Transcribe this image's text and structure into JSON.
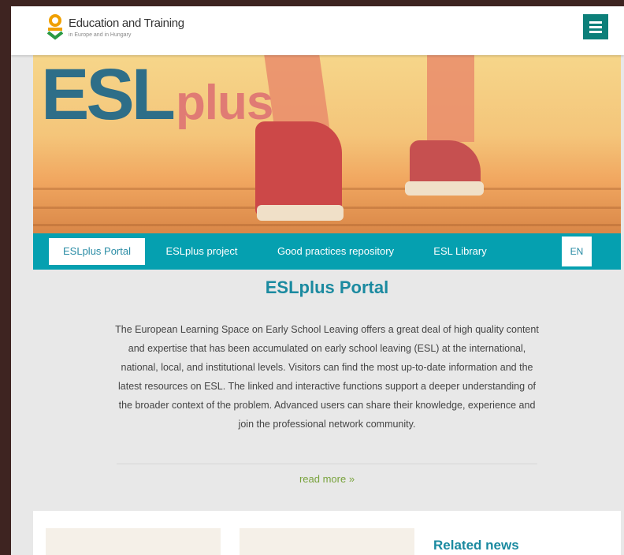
{
  "header": {
    "logo_title": "Education and Training",
    "logo_subtitle": "in Europe and in Hungary",
    "menu_icon": "hamburger-menu-icon"
  },
  "hero": {
    "brand_esl": "ESL",
    "brand_plus": "plus"
  },
  "nav": {
    "items": [
      "ESLplus Portal",
      "ESLplus project",
      "Good practices repository",
      "ESL Library"
    ],
    "active_index": 0,
    "lang": "EN"
  },
  "main": {
    "title": "ESLplus Portal",
    "intro": "The European Learning Space on Early School Leaving offers a great deal of high quality content and expertise that has been accumulated on early school leaving (ESL) at the international, national, local, and institutional levels. Visitors can find the most up-to-date information and the latest resources on ESL. The linked and interactive functions support a deeper understanding of the broader context of the problem. Advanced users can share their knowledge, experience and join the professional network community.",
    "read_more": "read more »"
  },
  "related": {
    "title": "Related news"
  },
  "colors": {
    "teal": "#05a0b0",
    "title_teal": "#1b8aa0",
    "green": "#78a23c",
    "menu_green": "#0c7f79"
  }
}
